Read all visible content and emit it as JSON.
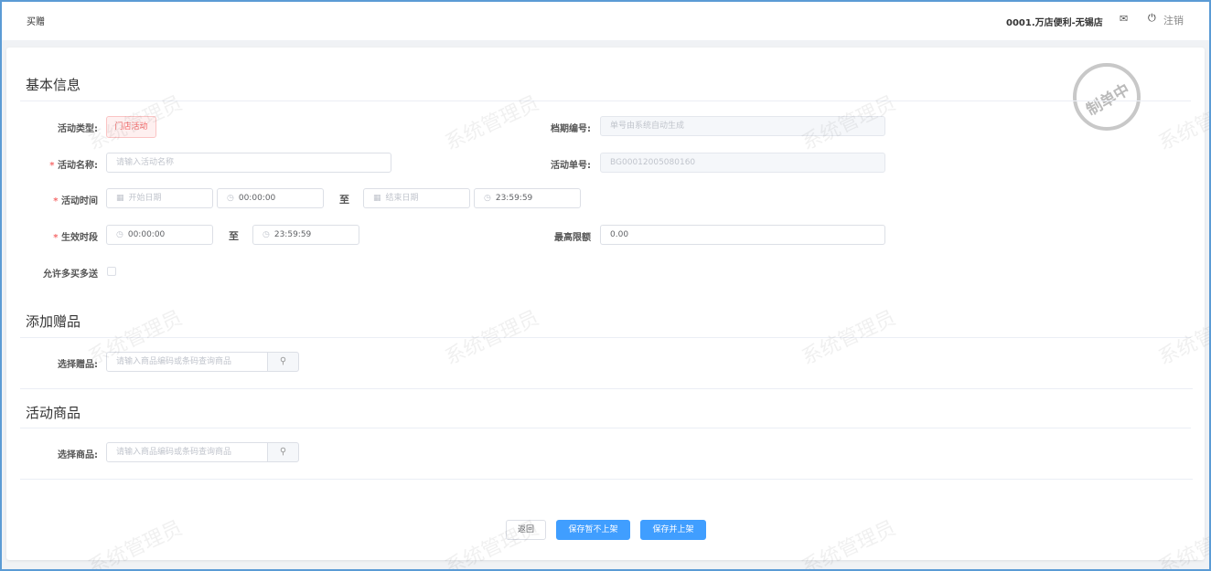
{
  "header": {
    "title": "买赠",
    "store": "0001.万店便利-无锡店",
    "logout": "注销"
  },
  "stamp": "制单中",
  "watermark": "系统管理员",
  "basic": {
    "title": "基本信息",
    "type_label": "活动类型:",
    "type_value": "门店活动",
    "period_label": "档期编号:",
    "period_placeholder": "单号由系统自动生成",
    "name_label": "活动名称:",
    "name_placeholder": "请输入活动名称",
    "order_label": "活动单号:",
    "order_value": "BG00012005080160",
    "time_label": "活动时间",
    "start_date_placeholder": "开始日期",
    "start_time": "00:00:00",
    "to": "至",
    "end_date_placeholder": "结束日期",
    "end_time": "23:59:59",
    "effective_label": "生效时段",
    "eff_start": "00:00:00",
    "eff_end": "23:59:59",
    "limit_label": "最高限额",
    "limit_value": "0.00",
    "multi_label": "允许多买多送"
  },
  "gift": {
    "title": "添加赠品",
    "label": "选择赠品:",
    "placeholder": "请输入商品编码或条码查询商品"
  },
  "goods": {
    "title": "活动商品",
    "label": "选择商品:",
    "placeholder": "请输入商品编码或条码查询商品"
  },
  "actions": {
    "back": "返回",
    "save_draft": "保存暂不上架",
    "save_publish": "保存并上架"
  }
}
